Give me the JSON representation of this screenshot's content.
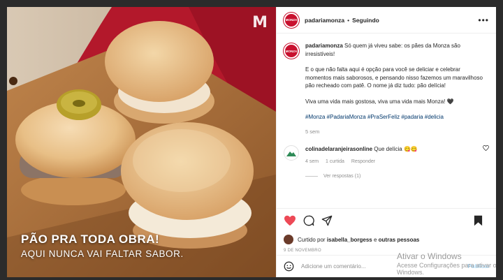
{
  "photo": {
    "brand_mark": "M",
    "caption_line1": "PÃO PRA TODA OBRA!",
    "caption_line2": "AQUI NUNCA VAI FALTAR SABOR."
  },
  "header": {
    "logo_text": "MONZA",
    "username": "padariamonza",
    "separator": "•",
    "follow_label": "Seguindo",
    "more_label": "•••"
  },
  "post": {
    "username": "padariamonza",
    "p1": "Só quem já viveu sabe: os pães da Monza são irresistíveis!",
    "p2": "E o que não falta aqui é opção para você se deliciar e celebrar momentos mais saborosos, e pensando nisso fazemos um maravilhoso pão recheado com patê. O nome já diz tudo: pão delícia!",
    "p3": "Viva uma vida mais gostosa, viva uma vida mais Monza! 🖤",
    "hashtags": "#Monza #PadariaMonza #PraSerFeliz #padaria #delicia",
    "age": "5 sem"
  },
  "comment": {
    "username": "colinadelaranjeirasonline",
    "text": "Que delícia 😋😋",
    "age": "4 sem",
    "likes": "1 curtida",
    "reply_label": "Responder",
    "view_replies": "Ver respostas (1)"
  },
  "actions": {
    "liked_by_prefix": "Curtido por",
    "liked_by_user": "isabella_borgess",
    "liked_by_connector": "e",
    "liked_by_others": "outras pessoas",
    "date": "9 DE NOVEMBRO"
  },
  "add_comment": {
    "placeholder": "Adicione um comentário...",
    "publish_label": "Publicar"
  },
  "watermark": {
    "line1": "Ativar o Windows",
    "line2": "Acesse Configurações para ativar o Windows."
  },
  "colors": {
    "brand_red": "#c8102e",
    "liked_heart": "#ed4956",
    "hashtag_blue": "#00376b"
  }
}
